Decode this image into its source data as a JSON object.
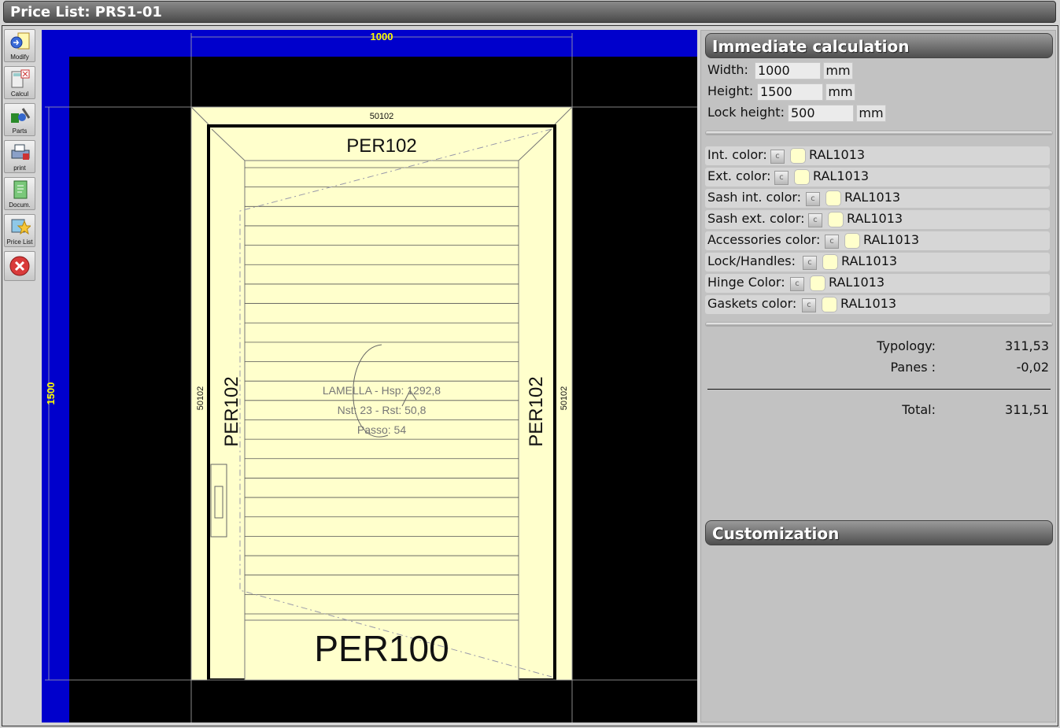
{
  "window": {
    "title": "Price List: PRS1-01"
  },
  "toolbar": {
    "modify": "Modify",
    "calcul": "Calcul",
    "parts": "Parts",
    "print": "print",
    "docum": "Docum.",
    "price_list": "Price List"
  },
  "drawing": {
    "dim_width": "1000",
    "dim_height": "1500",
    "profile_top": "50102",
    "profile_left": "50102",
    "profile_right": "50102",
    "sash_top": "PER102",
    "sash_left": "PER102",
    "sash_right": "PER102",
    "sash_bottom": "PER100",
    "infill_line1": "LAMELLA - Hsp: 1292,8",
    "infill_line2": "Nst: 23 - Rst: 50,8",
    "infill_line3": "Passo: 54",
    "lamella_count": 23
  },
  "immediate": {
    "header": "Immediate calculation",
    "width_label": "Width:",
    "width_value": "1000",
    "height_label": "Height:",
    "height_value": "1500",
    "lock_label": "Lock height:",
    "lock_value": "500",
    "unit": "mm"
  },
  "colors": [
    {
      "label": "Int. color:",
      "value": "RAL1013"
    },
    {
      "label": "Ext. color:",
      "value": "RAL1013"
    },
    {
      "label": "Sash int. color:",
      "value": "RAL1013"
    },
    {
      "label": "Sash ext. color:",
      "value": "RAL1013"
    },
    {
      "label": "Accessories color:",
      "value": "RAL1013"
    },
    {
      "label": "Lock/Handles:",
      "value": "RAL1013"
    },
    {
      "label": "Hinge Color:",
      "value": "RAL1013"
    },
    {
      "label": "Gaskets color:",
      "value": "RAL1013"
    }
  ],
  "color_button": "c",
  "swatch_color": "#FFFFCC",
  "totals": {
    "typology_label": "Typology:",
    "typology_value": "311,53",
    "panes_label": "Panes :",
    "panes_value": "-0,02",
    "total_label": "Total:",
    "total_value": "311,51"
  },
  "customization": {
    "header": "Customization"
  },
  "theme": {
    "blue_band": "#0000CC",
    "frame_fill": "#FFFFCC",
    "dim_color": "#FFFF00"
  }
}
